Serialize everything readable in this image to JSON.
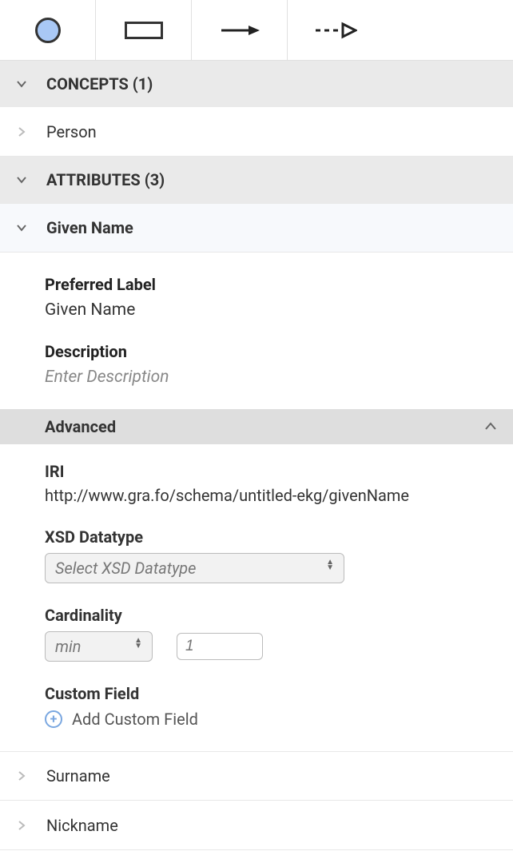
{
  "sections": {
    "concepts": {
      "header": "CONCEPTS (1)",
      "items": [
        {
          "label": "Person"
        }
      ]
    },
    "attributes": {
      "header": "ATTRIBUTES (3)",
      "items": [
        {
          "label": "Given Name"
        },
        {
          "label": "Surname"
        },
        {
          "label": "Nickname"
        }
      ]
    }
  },
  "details": {
    "preferredLabel": {
      "label": "Preferred Label",
      "value": "Given Name"
    },
    "description": {
      "label": "Description",
      "placeholder": "Enter Description"
    },
    "advanced": {
      "label": "Advanced",
      "iri": {
        "label": "IRI",
        "value": "http://www.gra.fo/schema/untitled-ekg/givenName"
      },
      "xsd": {
        "label": "XSD Datatype",
        "placeholder": "Select XSD Datatype"
      },
      "cardinality": {
        "label": "Cardinality",
        "mode": "min",
        "valuePlaceholder": "1"
      },
      "customField": {
        "label": "Custom Field",
        "addLabel": "Add Custom Field"
      }
    }
  }
}
